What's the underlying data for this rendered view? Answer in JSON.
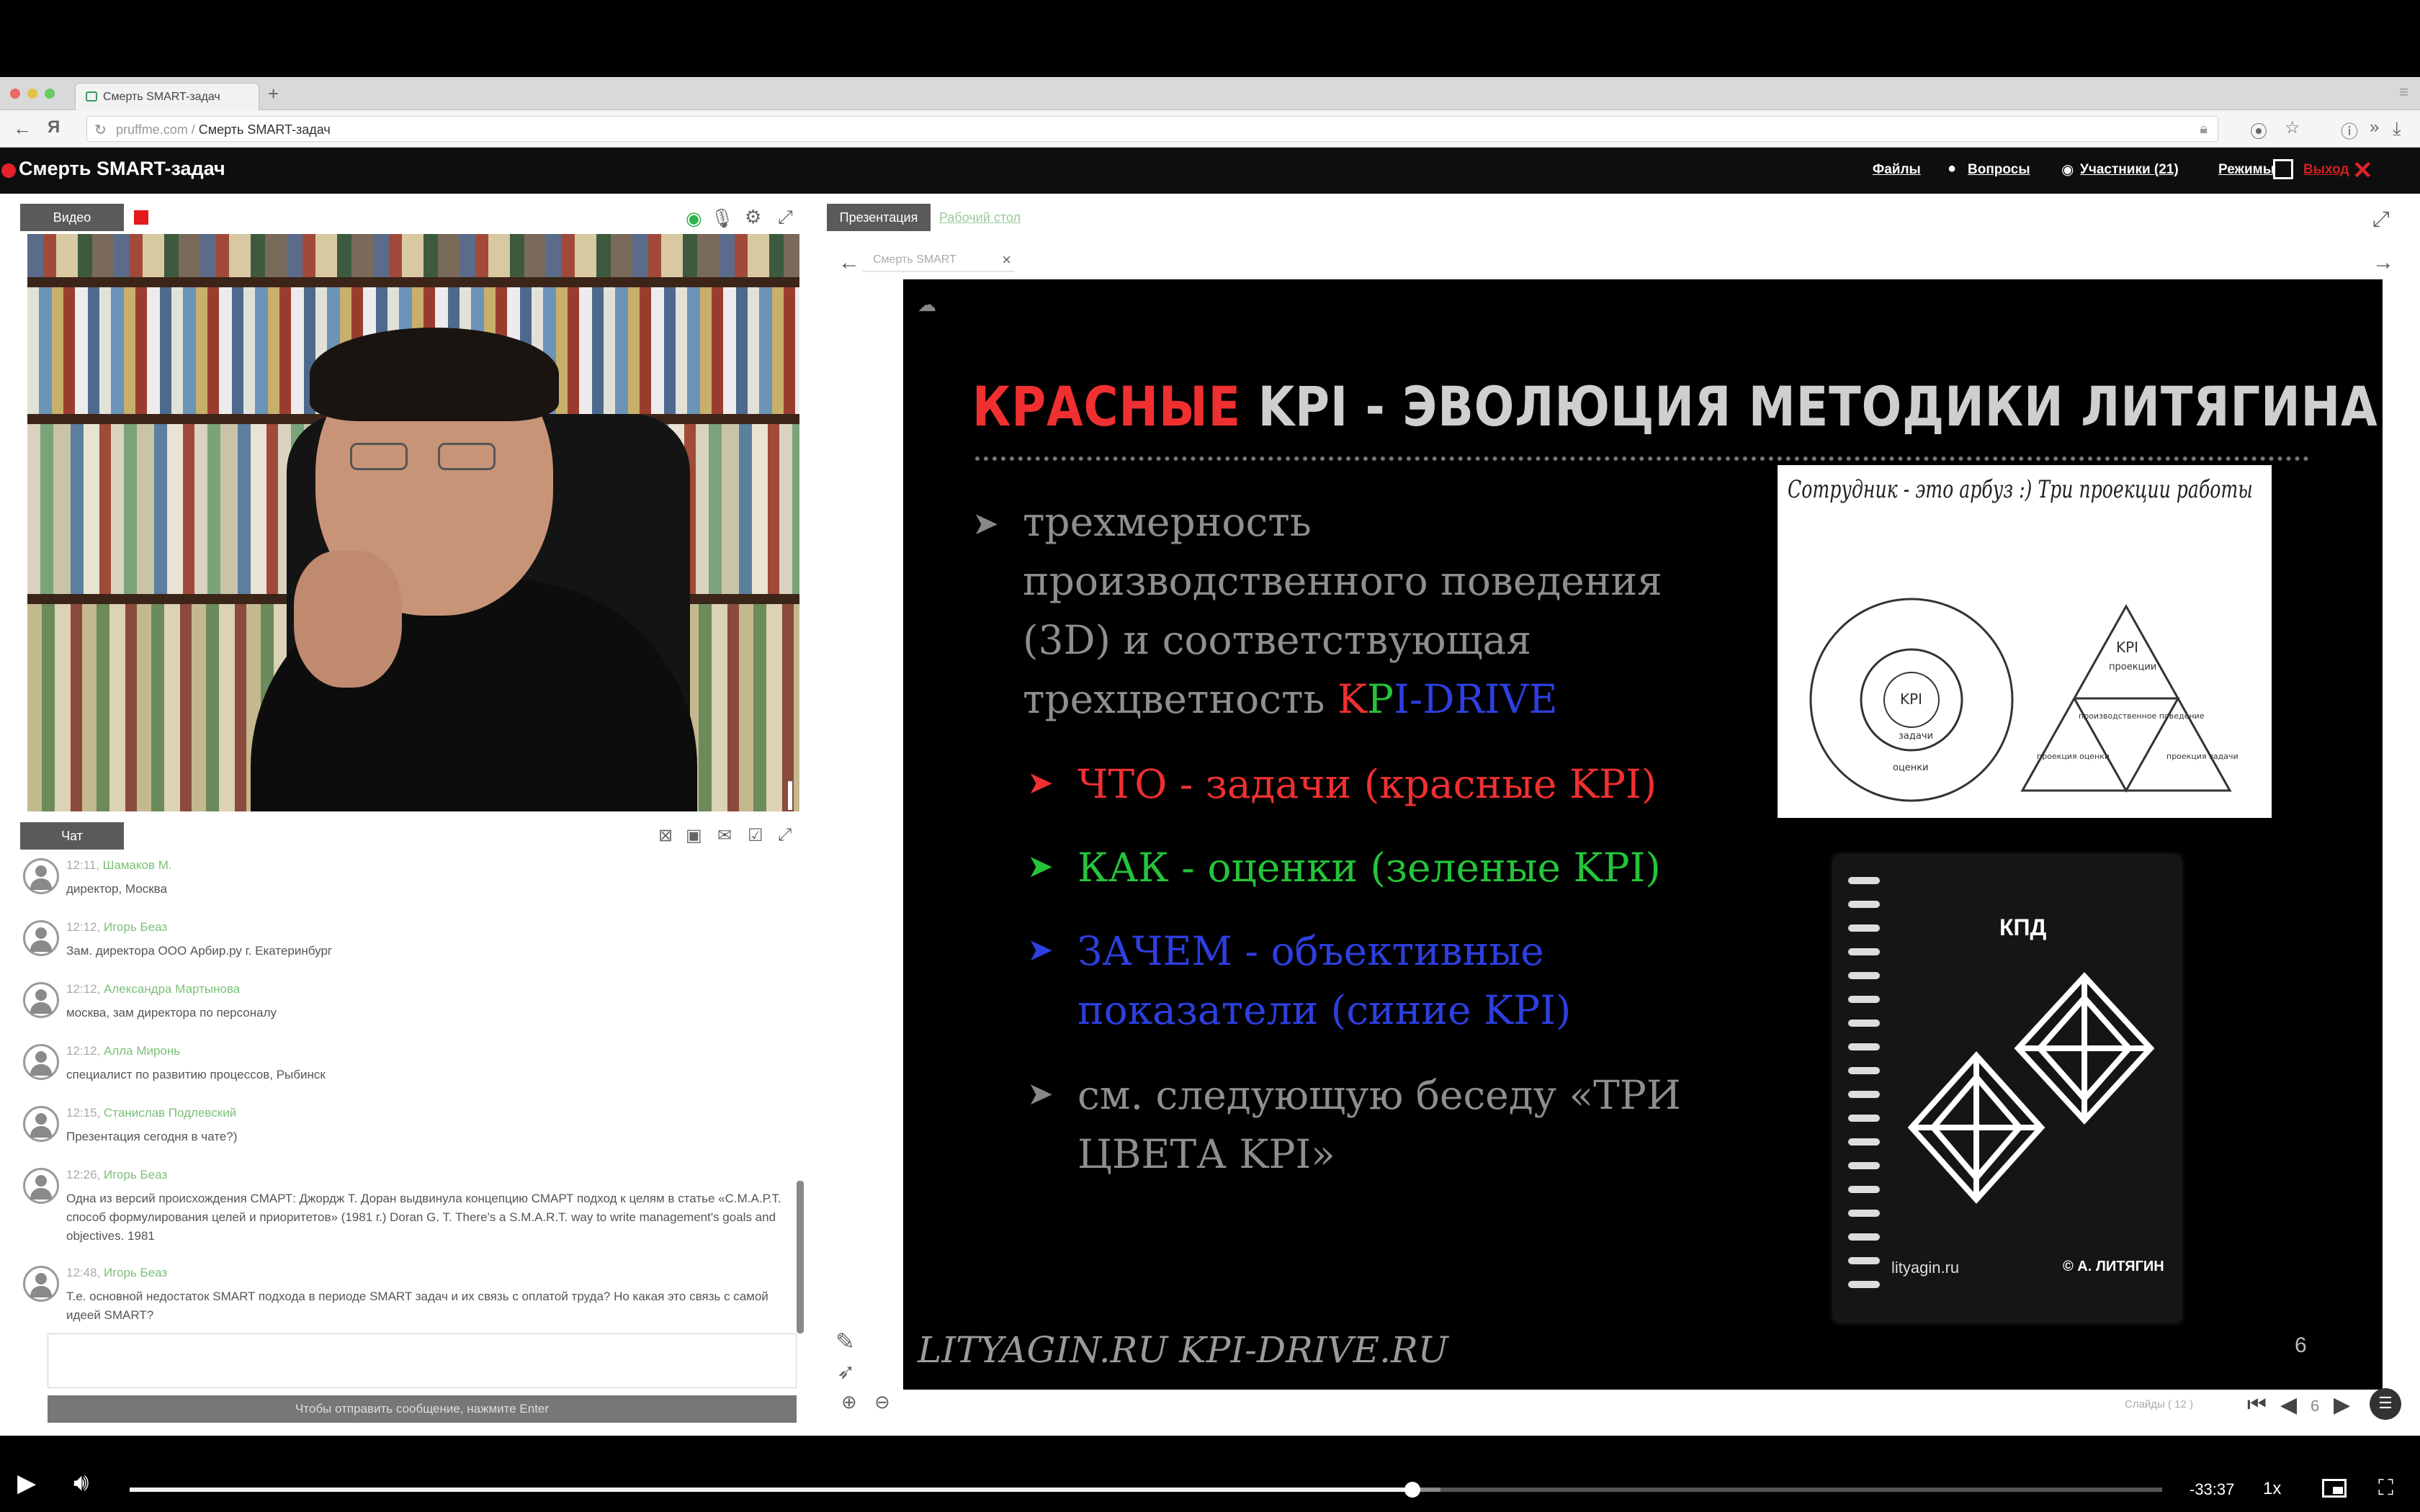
{
  "browser": {
    "tab_title": "Смерть SMART-задач",
    "new_tab": "+",
    "address_host": "pruffme.com",
    "address_sep": " / ",
    "address_page": "Смерть SMART-задач"
  },
  "app": {
    "title": "Смерть SMART-задач",
    "links": {
      "files": "Файлы",
      "questions": "Вопросы",
      "participants": "Участники (21)",
      "modes": "Режимы",
      "exit": "Выход"
    }
  },
  "video_panel": {
    "tab": "Видео"
  },
  "chat_panel": {
    "tab": "Чат"
  },
  "chat": [
    {
      "time": "12:11",
      "name": "Шамаков М.",
      "text": "директор, Москва"
    },
    {
      "time": "12:12",
      "name": "Игорь Беаз",
      "text": "Зам. директора ООО Арбир.ру г. Екатеринбург"
    },
    {
      "time": "12:12",
      "name": "Александра Мартынова",
      "text": "москва, зам директора по персоналу"
    },
    {
      "time": "12:12",
      "name": "Алла Миронь",
      "text": "специалист по развитию процессов, Рыбинск"
    },
    {
      "time": "12:15",
      "name": "Станислав Подлевский",
      "text": "Презентация сегодня в чате?)"
    },
    {
      "time": "12:26",
      "name": "Игорь Беаз",
      "text": "Одна из версий происхождения СМАРТ: Джордж Т. Доран выдвинула концепцию СМАРТ подход к целям в статье «С.М.А.Р.Т. способ формулирования целей и приоритетов» (1981 г.) Doran G. T. There's a S.M.A.R.T. way to write management's goals and objectives. 1981"
    },
    {
      "time": "12:48",
      "name": "Игорь Беаз",
      "text": "Т.е. основной недостаток SMART подхода в периоде SMART задач и их связь с оплатой труда? Но какая это связь с самой идеей SMART?"
    }
  ],
  "chat_send_hint": "Чтобы отправить сообщение, нажмите Enter",
  "presentation": {
    "tab_active": "Презентация",
    "tab_inactive": "Рабочий стол",
    "slide_tab": "Смерть SMART",
    "slide_tab_close": "×",
    "slide": {
      "title_red": "КРАСНЫЕ",
      "title_rest": " KPI - ЭВОЛЮЦИЯ МЕТОДИКИ ЛИТЯГИНА",
      "p1_line1": "трехмерность",
      "p1_line2": "производственного поведения",
      "p1_line3": "(3D) и соответствующая",
      "p1_line4_prefix": "трехцветность ",
      "kpi_k": "K",
      "kpi_p": "P",
      "kpi_rest": "I-DRIVE",
      "b_red": "ЧТО - задачи (красные KPI)",
      "b_green": "КАК - оценки (зеленые KPI)",
      "b_blue_1": "ЗАЧЕМ - объективные",
      "b_blue_2": "показатели (синие KPI)",
      "b_gray_1": "см. следующую беседу «ТРИ",
      "b_gray_2": "ЦВЕТА KPI»",
      "sketch_title": "Сотрудник - это арбуз :) Три проекции работы",
      "sketch_kpi_circle": "KPI",
      "sketch_zadachi": "задачи",
      "sketch_otsenki": "оценки",
      "sketch_kpi_tri": "KPI",
      "sketch_proektsii": "проекции",
      "sketch_center": "производственное поведение",
      "sketch_bl": "проекция оценки",
      "sketch_br": "проекция задачи",
      "book_title": "КПД",
      "book_brand": "lityagin.ru",
      "book_author": "© А. ЛИТЯГИН",
      "footer": "LITYAGIN.RU  KPI-DRIVE.RU",
      "number": "6"
    },
    "counter": "Слайды ( 12 )",
    "current_slide": "6"
  },
  "player": {
    "remaining": "-33:37",
    "speed": "1x",
    "progress_fraction": 0.631,
    "buffer_fraction": 0.645
  },
  "colors": {
    "red": "#f03030",
    "green": "#25c43a",
    "blue": "#2d3fe0",
    "header_bg": "#0e0e0e"
  }
}
